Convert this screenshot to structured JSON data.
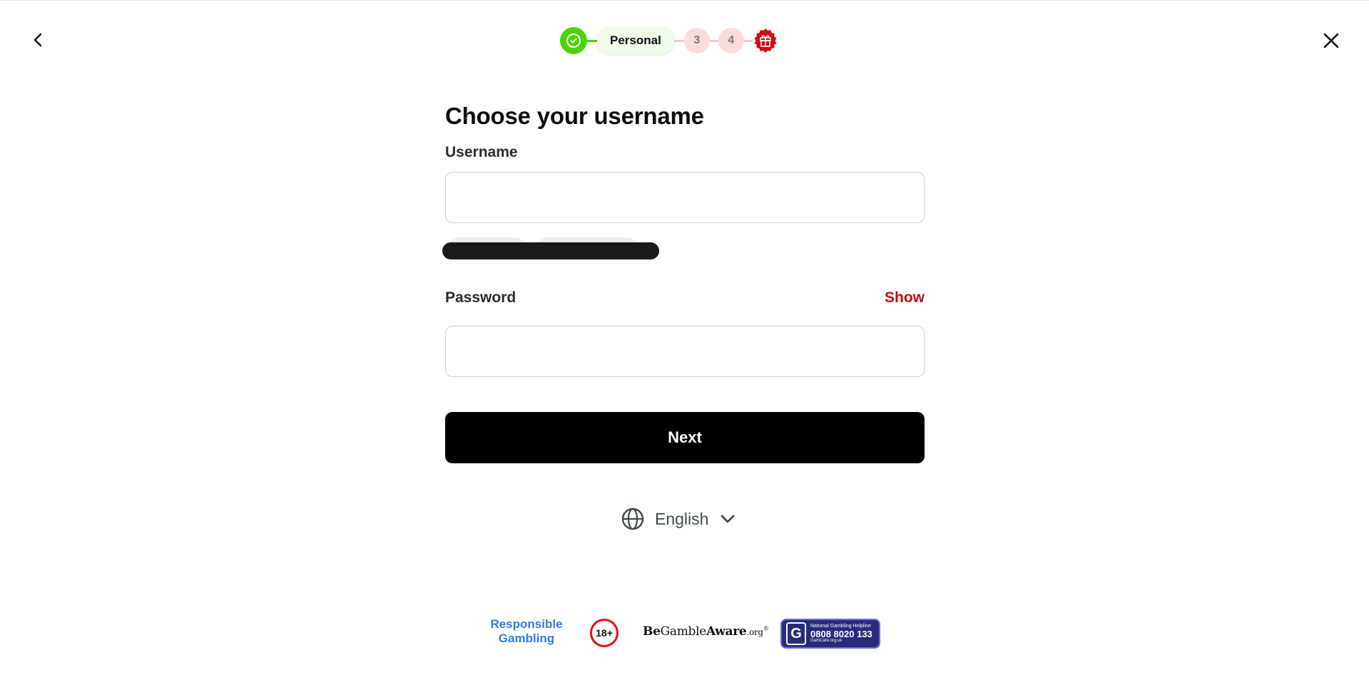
{
  "header": {
    "steps": [
      {
        "state": "done"
      },
      {
        "state": "current",
        "label": "Personal"
      },
      {
        "state": "upcoming",
        "label": "3"
      },
      {
        "state": "upcoming",
        "label": "4"
      },
      {
        "state": "reward",
        "icon": "gift-icon"
      }
    ],
    "icons": {
      "back": "chevron-left-icon",
      "close": "close-icon"
    }
  },
  "form": {
    "title": "Choose your username",
    "username": {
      "label": "Username",
      "value": "",
      "placeholder": ""
    },
    "password": {
      "label": "Password",
      "value": "",
      "placeholder": "",
      "toggle_label": "Show"
    },
    "next_label": "Next"
  },
  "language": {
    "selected": "English",
    "icon": "globe-icon"
  },
  "footer": {
    "responsible_gambling": "Responsible Gambling",
    "age_badge": "18+",
    "begambleaware": {
      "be": "Be",
      "gamble": "Gamble",
      "aware": "Aware",
      "org": ".org",
      "mark": "®"
    },
    "gamcare": {
      "letter": "G",
      "line1": "National Gambling Helpline",
      "phone": "0808 8020 133",
      "site": "GamCare.org.uk"
    }
  },
  "colors": {
    "accent_green": "#4cd40a",
    "accent_red": "#c40d0d",
    "primary_button": "#000000",
    "rg_blue": "#2f7ce1"
  }
}
